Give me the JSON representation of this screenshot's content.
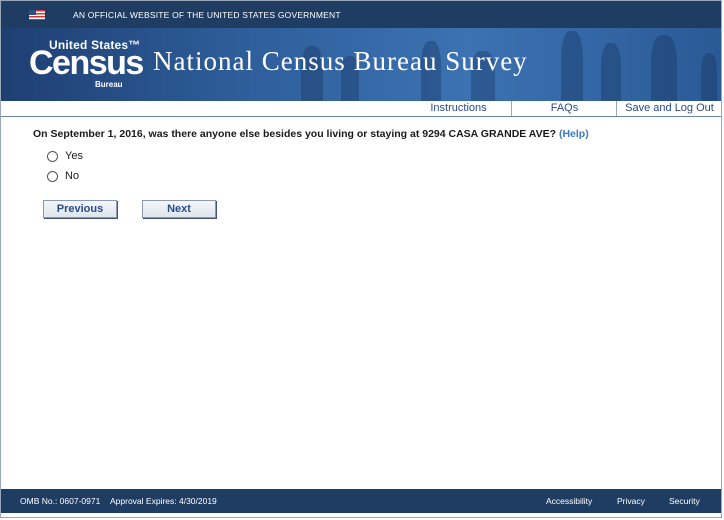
{
  "gov_bar": {
    "text": "AN OFFICIAL WEBSITE OF THE UNITED STATES GOVERNMENT",
    "flag_icon": "us-flag-icon"
  },
  "banner": {
    "logo_top": "United States™",
    "logo_main": "Census",
    "logo_sub": "Bureau",
    "title": "National Census Bureau Survey"
  },
  "nav": {
    "instructions": "Instructions",
    "faqs": "FAQs",
    "save_logout": "Save and Log Out"
  },
  "question": {
    "text": "On September 1, 2016, was there anyone else besides you living or staying at 9294 CASA GRANDE AVE?",
    "help": "(Help)",
    "options": [
      {
        "label": "Yes"
      },
      {
        "label": "No"
      }
    ]
  },
  "buttons": {
    "previous": "Previous",
    "next": "Next"
  },
  "footer": {
    "omb": "OMB No.: 0607-0971",
    "approval": "Approval Expires: 4/30/2019",
    "accessibility": "Accessibility",
    "privacy": "Privacy",
    "security": "Security"
  },
  "colors": {
    "header_navy": "#1f3d63",
    "link_blue": "#2b4b89",
    "help_blue": "#3b79c4"
  }
}
